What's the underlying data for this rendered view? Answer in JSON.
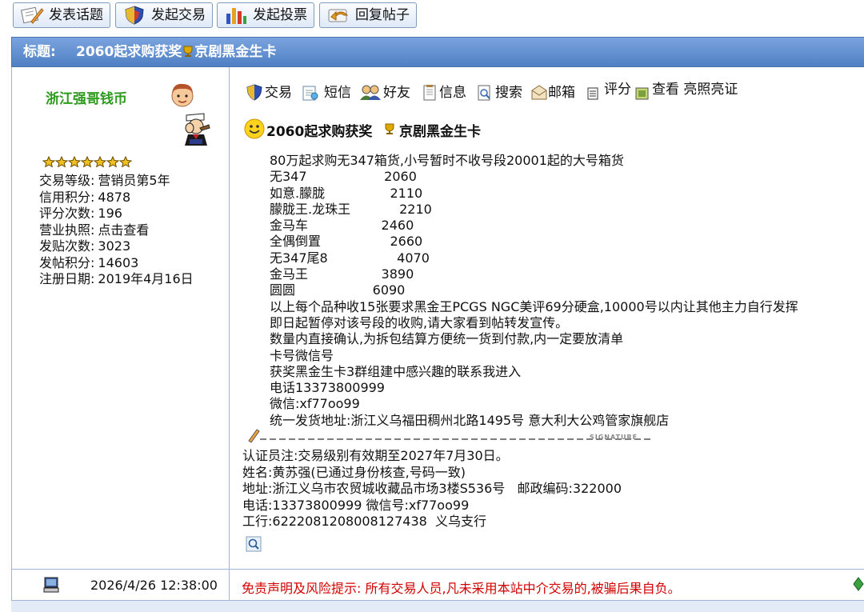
{
  "toolbar": {
    "buttons": [
      {
        "label": "发表话题",
        "icon": "pencil-paper-icon"
      },
      {
        "label": "发起交易",
        "icon": "shield-icon"
      },
      {
        "label": "发起投票",
        "icon": "bar-chart-icon"
      },
      {
        "label": "回复帖子",
        "icon": "reply-icon"
      }
    ]
  },
  "thread": {
    "title_label": "标题:",
    "title_part1": "2060起求购获奖",
    "title_part2": "京剧黑金生卡"
  },
  "user": {
    "name": "浙江强哥钱币",
    "stars": 7,
    "info": [
      {
        "key": "交易等级:",
        "value": "营销员第5年"
      },
      {
        "key": "信用积分:",
        "value": "4878"
      },
      {
        "key": "评分次数:",
        "value": "196"
      },
      {
        "key": "营业执照:",
        "value": "点击查看"
      },
      {
        "key": "发贴次数:",
        "value": "3023"
      },
      {
        "key": "发帖积分:",
        "value": "14603"
      },
      {
        "key": "注册日期:",
        "value": "2019年4月16日"
      }
    ]
  },
  "actions": [
    {
      "label": "交易",
      "icon": "shield-icon"
    },
    {
      "label": "短信",
      "icon": "message-icon"
    },
    {
      "label": "好友",
      "icon": "friends-icon"
    },
    {
      "label": "信息",
      "icon": "info-document-icon"
    },
    {
      "label": "搜索",
      "icon": "search-document-icon"
    },
    {
      "label": "邮箱",
      "icon": "mail-icon"
    },
    {
      "label": "评分",
      "icon": "rating-list-icon"
    },
    {
      "label": "查看 亮照亮证",
      "icon": "view-license-icon"
    }
  ],
  "post": {
    "title_part1": "2060起求购获奖",
    "title_part2": "京剧黑金生卡",
    "lines": [
      "80万起求购无347箱货,小号暂时不收号段20001起的大号箱货",
      "无347                   2060",
      "如意.朦胧                2110",
      "朦胧王.龙珠王            2210",
      "金马车                  2460",
      "全偶倒置                 2660",
      "无347尾8                 4070",
      "金马王                  3890",
      "圆圆                   6090",
      "以上每个品种收15张要求黑金王PCGS NGC美评69分硬盒,10000号以内让其他主力自行发挥",
      "即日起暂停对该号段的收购,请大家看到帖转发宣传。",
      "数量内直接确认,为拆包结算方便统一货到付款,内一定要放清单",
      "卡号微信号",
      "获奖黑金生卡3群组建中感兴趣的联系我进入",
      "电话13373800999",
      "微信:xf77oo99",
      "统一发货地址:浙江义乌福田稠州北路1495号 意大利大公鸡管家旗舰店"
    ],
    "signature_label": "SIGNATURE",
    "cert_lines": [
      "认证员注:交易级别有效期至2027年7月30日。",
      "姓名:黄苏强(已通过身份核查,号码一致)",
      "地址:浙江义乌市农贸城收藏品市场3楼S536号   邮政编码:322000",
      "电话:13373800999 微信号:xf77oo99",
      "工行:6222081208008127438  义乌支行"
    ]
  },
  "footer": {
    "timestamp": "2026/4/26 12:38:00",
    "disclaimer": "免责声明及风险提示: 所有交易人员,凡未采用本站中介交易的,被骗后果自负。"
  },
  "colors": {
    "title_bar": "#5f8ccc",
    "username": "#2e9a1e",
    "disclaimer": "#d40000",
    "border": "#9fb6d8"
  }
}
